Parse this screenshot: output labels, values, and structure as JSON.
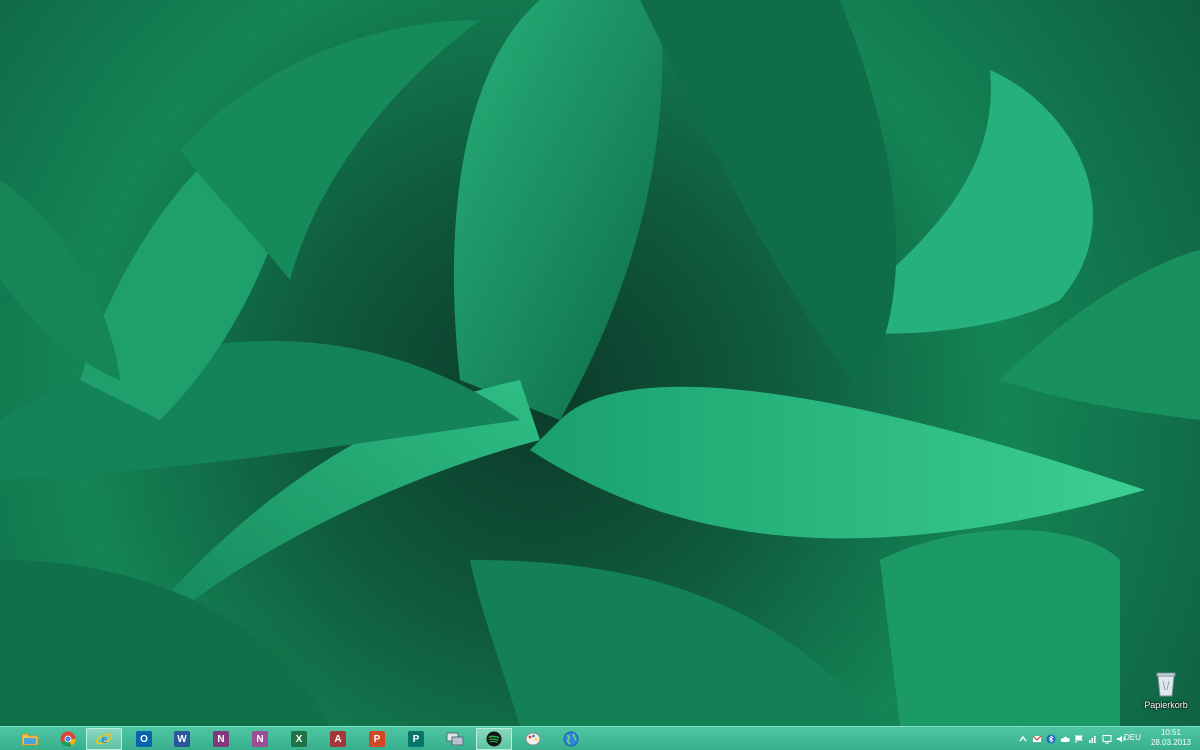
{
  "desktop": {
    "wallpaper": "green-leaves-wallpaper",
    "icons": [
      {
        "label": "Papierkorb",
        "icon": "recycle-bin-icon"
      }
    ]
  },
  "taskbar": {
    "apps": [
      {
        "name": "file-explorer",
        "icon": "folder-icon",
        "color": "#e8b94a"
      },
      {
        "name": "chrome",
        "icon": "chrome-icon",
        "color": "#db4437"
      },
      {
        "name": "internet-explorer",
        "icon": "ie-icon",
        "color": "#1e88e5",
        "active": true
      },
      {
        "name": "outlook",
        "icon": "outlook-icon",
        "color": "#0a64ad",
        "glyph": "O"
      },
      {
        "name": "word",
        "icon": "word-icon",
        "color": "#2b579a",
        "glyph": "W"
      },
      {
        "name": "onenote",
        "icon": "onenote-icon",
        "color": "#80397b",
        "glyph": "N"
      },
      {
        "name": "onenote-2",
        "icon": "onenote-alt-icon",
        "color": "#80397b",
        "glyph": "N"
      },
      {
        "name": "excel",
        "icon": "excel-icon",
        "color": "#217346",
        "glyph": "X"
      },
      {
        "name": "access",
        "icon": "access-icon",
        "color": "#a4373a",
        "glyph": "A"
      },
      {
        "name": "powerpoint",
        "icon": "powerpoint-icon",
        "color": "#d24726",
        "glyph": "P"
      },
      {
        "name": "publisher",
        "icon": "publisher-icon",
        "color": "#077568",
        "glyph": "P"
      },
      {
        "name": "remote-desktop",
        "icon": "remote-desktop-icon",
        "color": "#5b6b7a"
      },
      {
        "name": "spotify",
        "icon": "spotify-icon",
        "color": "#1db954",
        "active": true
      },
      {
        "name": "paint",
        "icon": "paint-icon",
        "color": "#c0392b"
      },
      {
        "name": "globe-app",
        "icon": "globe-icon",
        "color": "#2e86de"
      }
    ],
    "tray": {
      "icons": [
        "chevron-up-icon",
        "mail-tray-icon",
        "bluetooth-icon",
        "cloud-icon",
        "flag-icon",
        "network-icon",
        "action-icon",
        "volume-icon"
      ],
      "language": "DEU",
      "time": "10:51",
      "date": "28.03.2013"
    }
  }
}
